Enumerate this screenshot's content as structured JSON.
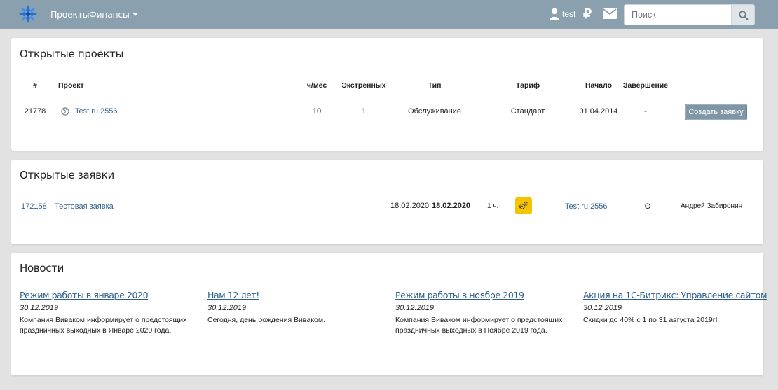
{
  "header": {
    "nav": [
      {
        "label": "Проекты"
      },
      {
        "label": "Финансы"
      }
    ],
    "user_name": "test",
    "ruble_symbol": "₽",
    "search_placeholder": "Поиск"
  },
  "projects": {
    "title": "Открытые проекты",
    "columns": [
      "#",
      "Проект",
      "ч/мес",
      "Экстренных",
      "Тип",
      "Тариф",
      "Начало",
      "Завершение"
    ],
    "rows": [
      {
        "id": "21778",
        "name": "Test.ru 2556",
        "hours": "10",
        "urgent": "1",
        "type": "Обслуживание",
        "tariff": "Стандарт",
        "start": "01.04.2014",
        "end": "-",
        "action": "Создать заявку"
      }
    ]
  },
  "tickets": {
    "title": "Открытые заявки",
    "rows": [
      {
        "id": "172158",
        "name": "Тестовая заявка",
        "created": "18.02.2020",
        "deadline": "18.02.2020",
        "time": "1 ч.",
        "project": "Test.ru 2556",
        "status": "О",
        "assignee": "Андрей Забиронин"
      }
    ]
  },
  "news": {
    "title": "Новости",
    "items": [
      {
        "title": "Режим работы в январе 2020",
        "date": "30.12.2019",
        "text": "Компания Вивaком информирует о предстоящих праздничных выходных в Январе 2020 года."
      },
      {
        "title": "Нам 12 лет!",
        "date": "30.12.2019",
        "text": "Сегодня, день рождения Вивaком."
      },
      {
        "title": "Режим работы в ноябре 2019",
        "date": "30.12.2019",
        "text": "Компания Вивaком информирует о предстоящих праздничных выходных в Ноябре 2019 года."
      },
      {
        "title": "Акция на 1С-Битрикс: Управление сайтом",
        "date": "30.12.2019",
        "text": "Скидки до 40% с 1 по 31 августа 2019г!"
      }
    ]
  },
  "colors": {
    "navbar": "#8aa0ae",
    "link": "#2f5f8a",
    "button": "#7f96a6",
    "badge": "#f5c400",
    "logo": "#1e6fd9"
  }
}
